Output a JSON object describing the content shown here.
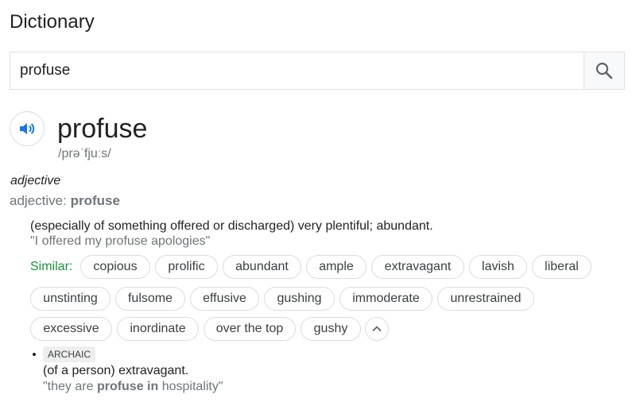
{
  "title": "Dictionary",
  "search": {
    "value": "profuse"
  },
  "entry": {
    "word": "profuse",
    "phonetic": "/prəˈfjuːs/",
    "part_of_speech": "adjective",
    "pos_label": "adjective:",
    "pos_word": "profuse",
    "definitions": [
      {
        "text": "(especially of something offered or discharged) very plentiful; abundant.",
        "example": "\"I offered my profuse apologies\"",
        "similar_label": "Similar:",
        "similar": [
          "copious",
          "prolific",
          "abundant",
          "ample",
          "extravagant",
          "lavish",
          "liberal",
          "unstinting",
          "fulsome",
          "effusive",
          "gushing",
          "immoderate",
          "unrestrained",
          "excessive",
          "inordinate",
          "over the top",
          "gushy"
        ]
      },
      {
        "label": "ARCHAIC",
        "text": "(of a person) extravagant.",
        "example_pre": "\"they are ",
        "example_bold": "profuse in",
        "example_post": " hospitality\""
      }
    ]
  }
}
